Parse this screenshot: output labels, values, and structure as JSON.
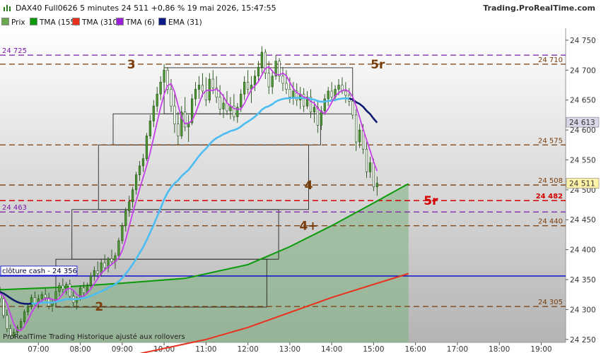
{
  "header": {
    "title": "DAX40 Full0626 5 minutes 24 511 +0,86 % 19 mai 2026, 15:47:55",
    "brand": "Trading.ProRealTime.com"
  },
  "legend": [
    {
      "label": "Prix",
      "color": "#6aa84f"
    },
    {
      "label": "TMA (155)",
      "color": "#0a9a0a"
    },
    {
      "label": "TMA (310)",
      "color": "#e8301c"
    },
    {
      "label": "TMA (6)",
      "color": "#9b1fd6"
    },
    {
      "label": "EMA (31)",
      "color": "#0d1a8a"
    }
  ],
  "footer_note": "ProRealTime Trading  Historique ajusté aux rollovers",
  "colors": {
    "bg_top": "#ffffff",
    "bg_bottom": "#b4b4b4",
    "candle_up": "#2d7a1e",
    "candle_down": "#2d7a1e",
    "tma155": "#0a9a0a",
    "tma310": "#e8301c",
    "tma6": "#c640e8",
    "ema31_light": "#4bbdf2",
    "ema31_dark": "#0d1a6e",
    "area_fill": "#7fb27f",
    "cash_line": "#0000cc",
    "level_brown": "#7a3d0c",
    "level_red": "#d40000",
    "level_purple": "#7a1aa8"
  },
  "chart_data": {
    "type": "candlestick",
    "instrument": "DAX40 Full0626",
    "timeframe": "5 minutes",
    "ylim": [
      24245,
      24770
    ],
    "xlim": [
      "06:05",
      "19:35"
    ],
    "x_ticks": [
      "07:00",
      "08:00",
      "09:00",
      "10:00",
      "11:00",
      "12:00",
      "13:00",
      "14:00",
      "15:00",
      "16:00",
      "17:00",
      "18:00",
      "19:00"
    ],
    "y_ticks": [
      24250,
      24300,
      24350,
      24400,
      24450,
      24500,
      24550,
      24600,
      24650,
      24700,
      24750
    ],
    "y_tick_labels": [
      "24 250",
      "24 300",
      "24 350",
      "24 400",
      "24 450",
      "24 500",
      "24 550",
      "24 600",
      "24 650",
      "24 700",
      "24 750"
    ],
    "last_price": {
      "label": "24 511",
      "value": 24511
    },
    "ema_label": {
      "label": "24 613",
      "value": 24613
    },
    "levels": [
      {
        "value": 24725,
        "label": "24 725",
        "side": "left",
        "style": "purple"
      },
      {
        "value": 24710,
        "label": "24 710",
        "side": "right",
        "style": "brown"
      },
      {
        "value": 24575,
        "label": "24 575",
        "side": "right",
        "style": "brown"
      },
      {
        "value": 24508,
        "label": "24 508",
        "side": "right",
        "style": "brown"
      },
      {
        "value": 24482,
        "label": "24 482",
        "side": "right",
        "style": "red"
      },
      {
        "value": 24463,
        "label": "24 463",
        "side": "left",
        "style": "purple"
      },
      {
        "value": 24440,
        "label": "24 440",
        "side": "right",
        "style": "brown"
      },
      {
        "value": 24305,
        "label": "24 305",
        "side": "right",
        "style": "brown"
      }
    ],
    "cash_close": {
      "label": "clôture cash -  24 356",
      "value": 24356
    },
    "annotations": [
      {
        "text": "3",
        "time": "09:13",
        "value": 24710,
        "color": "brown"
      },
      {
        "text": "5r",
        "time": "15:06",
        "value": 24710,
        "color": "brown"
      },
      {
        "text": "4",
        "time": "13:27",
        "value": 24508,
        "color": "brown"
      },
      {
        "text": "5r",
        "time": "16:22",
        "value": 24482,
        "color": "red"
      },
      {
        "text": "4+",
        "time": "13:27",
        "value": 24440,
        "color": "brown"
      },
      {
        "text": "2",
        "time": "08:27",
        "value": 24305,
        "color": "brown"
      }
    ],
    "boxes": [
      {
        "t0": "10:00",
        "t1": "14:30",
        "low": 24627,
        "high": 24704
      },
      {
        "t0": "08:47",
        "t1": "13:44",
        "low": 24575,
        "high": 24627
      },
      {
        "t0": "08:26",
        "t1": "13:27",
        "low": 24467,
        "high": 24575
      },
      {
        "t0": "07:48",
        "t1": "12:44",
        "low": 24384,
        "high": 24467
      },
      {
        "t0": "07:25",
        "t1": "12:27",
        "low": 24304,
        "high": 24384
      }
    ],
    "ohlc": [
      [
        "06:00",
        24345,
        24352,
        24325,
        24330
      ],
      [
        "06:05",
        24330,
        24338,
        24312,
        24318
      ],
      [
        "06:10",
        24318,
        24322,
        24285,
        24290
      ],
      [
        "06:15",
        24290,
        24300,
        24262,
        24268
      ],
      [
        "06:20",
        24268,
        24275,
        24250,
        24256
      ],
      [
        "06:25",
        24256,
        24268,
        24252,
        24262
      ],
      [
        "06:30",
        24262,
        24274,
        24258,
        24270
      ],
      [
        "06:35",
        24270,
        24285,
        24265,
        24280
      ],
      [
        "06:40",
        24280,
        24300,
        24276,
        24296
      ],
      [
        "06:45",
        24296,
        24310,
        24290,
        24305
      ],
      [
        "06:50",
        24305,
        24325,
        24300,
        24320
      ],
      [
        "06:55",
        24320,
        24330,
        24305,
        24310
      ],
      [
        "07:00",
        24310,
        24325,
        24302,
        24318
      ],
      [
        "07:05",
        24318,
        24330,
        24310,
        24325
      ],
      [
        "07:10",
        24325,
        24335,
        24315,
        24320
      ],
      [
        "07:15",
        24320,
        24328,
        24300,
        24306
      ],
      [
        "07:20",
        24306,
        24318,
        24296,
        24312
      ],
      [
        "07:25",
        24312,
        24335,
        24308,
        24330
      ],
      [
        "07:30",
        24330,
        24345,
        24322,
        24340
      ],
      [
        "07:35",
        24340,
        24352,
        24328,
        24334
      ],
      [
        "07:40",
        24334,
        24346,
        24325,
        24342
      ],
      [
        "07:45",
        24342,
        24350,
        24318,
        24322
      ],
      [
        "07:50",
        24322,
        24332,
        24305,
        24312
      ],
      [
        "07:55",
        24312,
        24322,
        24300,
        24318
      ],
      [
        "08:00",
        24318,
        24340,
        24315,
        24336
      ],
      [
        "08:05",
        24336,
        24346,
        24322,
        24328
      ],
      [
        "08:10",
        24328,
        24345,
        24326,
        24340
      ],
      [
        "08:15",
        24340,
        24362,
        24336,
        24356
      ],
      [
        "08:20",
        24356,
        24372,
        24348,
        24365
      ],
      [
        "08:25",
        24365,
        24380,
        24352,
        24360
      ],
      [
        "08:30",
        24360,
        24385,
        24355,
        24378
      ],
      [
        "08:35",
        24378,
        24392,
        24365,
        24370
      ],
      [
        "08:40",
        24370,
        24388,
        24362,
        24385
      ],
      [
        "08:45",
        24385,
        24400,
        24375,
        24380
      ],
      [
        "08:50",
        24380,
        24395,
        24368,
        24390
      ],
      [
        "08:55",
        24390,
        24420,
        24386,
        24415
      ],
      [
        "09:00",
        24415,
        24445,
        24410,
        24440
      ],
      [
        "09:05",
        24440,
        24470,
        24430,
        24465
      ],
      [
        "09:10",
        24465,
        24490,
        24455,
        24480
      ],
      [
        "09:15",
        24480,
        24505,
        24470,
        24500
      ],
      [
        "09:20",
        24500,
        24530,
        24492,
        24525
      ],
      [
        "09:25",
        24525,
        24548,
        24515,
        24540
      ],
      [
        "09:30",
        24540,
        24560,
        24530,
        24552
      ],
      [
        "09:35",
        24552,
        24595,
        24548,
        24590
      ],
      [
        "09:40",
        24590,
        24625,
        24585,
        24615
      ],
      [
        "09:45",
        24615,
        24650,
        24605,
        24640
      ],
      [
        "09:50",
        24640,
        24672,
        24630,
        24660
      ],
      [
        "09:55",
        24660,
        24690,
        24650,
        24680
      ],
      [
        "10:00",
        24680,
        24710,
        24670,
        24700
      ],
      [
        "10:05",
        24700,
        24705,
        24660,
        24668
      ],
      [
        "10:10",
        24668,
        24685,
        24630,
        24640
      ],
      [
        "10:15",
        24640,
        24660,
        24595,
        24610
      ],
      [
        "10:20",
        24610,
        24630,
        24575,
        24590
      ],
      [
        "10:25",
        24590,
        24640,
        24585,
        24630
      ],
      [
        "10:30",
        24630,
        24655,
        24598,
        24605
      ],
      [
        "10:35",
        24605,
        24625,
        24580,
        24612
      ],
      [
        "10:40",
        24612,
        24660,
        24608,
        24652
      ],
      [
        "10:45",
        24652,
        24680,
        24640,
        24668
      ],
      [
        "10:50",
        24668,
        24690,
        24652,
        24675
      ],
      [
        "10:55",
        24675,
        24695,
        24655,
        24665
      ],
      [
        "11:00",
        24665,
        24688,
        24640,
        24650
      ],
      [
        "11:05",
        24650,
        24695,
        24645,
        24685
      ],
      [
        "11:10",
        24685,
        24700,
        24660,
        24670
      ],
      [
        "11:15",
        24670,
        24690,
        24645,
        24655
      ],
      [
        "11:20",
        24655,
        24675,
        24625,
        24635
      ],
      [
        "11:25",
        24635,
        24660,
        24620,
        24645
      ],
      [
        "11:30",
        24645,
        24665,
        24625,
        24632
      ],
      [
        "11:35",
        24632,
        24655,
        24618,
        24640
      ],
      [
        "11:40",
        24640,
        24660,
        24615,
        24622
      ],
      [
        "11:45",
        24622,
        24645,
        24612,
        24638
      ],
      [
        "11:50",
        24638,
        24668,
        24630,
        24660
      ],
      [
        "11:55",
        24660,
        24690,
        24650,
        24680
      ],
      [
        "12:00",
        24680,
        24700,
        24660,
        24668
      ],
      [
        "12:05",
        24668,
        24690,
        24645,
        24675
      ],
      [
        "12:10",
        24675,
        24700,
        24665,
        24690
      ],
      [
        "12:15",
        24690,
        24715,
        24680,
        24705
      ],
      [
        "12:20",
        24705,
        24740,
        24695,
        24730
      ],
      [
        "12:25",
        24730,
        24735,
        24685,
        24695
      ],
      [
        "12:30",
        24695,
        24715,
        24660,
        24672
      ],
      [
        "12:35",
        24672,
        24700,
        24660,
        24690
      ],
      [
        "12:40",
        24690,
        24725,
        24684,
        24715
      ],
      [
        "12:45",
        24715,
        24720,
        24680,
        24690
      ],
      [
        "12:50",
        24690,
        24705,
        24665,
        24678
      ],
      [
        "12:55",
        24678,
        24700,
        24660,
        24668
      ],
      [
        "13:00",
        24668,
        24688,
        24645,
        24655
      ],
      [
        "13:05",
        24655,
        24680,
        24642,
        24665
      ],
      [
        "13:10",
        24665,
        24678,
        24640,
        24650
      ],
      [
        "13:15",
        24650,
        24672,
        24635,
        24660
      ],
      [
        "13:20",
        24660,
        24670,
        24630,
        24640
      ],
      [
        "13:25",
        24640,
        24665,
        24635,
        24655
      ],
      [
        "13:30",
        24655,
        24668,
        24620,
        24630
      ],
      [
        "13:35",
        24630,
        24648,
        24612,
        24638
      ],
      [
        "13:40",
        24638,
        24650,
        24595,
        24608
      ],
      [
        "13:45",
        24608,
        24640,
        24600,
        24632
      ],
      [
        "13:50",
        24632,
        24660,
        24625,
        24652
      ],
      [
        "13:55",
        24652,
        24672,
        24640,
        24665
      ],
      [
        "14:00",
        24665,
        24680,
        24645,
        24655
      ],
      [
        "14:05",
        24655,
        24675,
        24648,
        24668
      ],
      [
        "14:10",
        24668,
        24685,
        24658,
        24675
      ],
      [
        "14:15",
        24675,
        24688,
        24660,
        24665
      ],
      [
        "14:20",
        24665,
        24680,
        24645,
        24658
      ],
      [
        "14:25",
        24658,
        24670,
        24640,
        24648
      ],
      [
        "14:30",
        24648,
        24660,
        24618,
        24625
      ],
      [
        "14:35",
        24625,
        24635,
        24565,
        24580
      ],
      [
        "14:40",
        24580,
        24610,
        24570,
        24600
      ],
      [
        "14:45",
        24600,
        24610,
        24560,
        24568
      ],
      [
        "14:50",
        24568,
        24580,
        24520,
        24530
      ],
      [
        "14:55",
        24530,
        24555,
        24520,
        24545
      ],
      [
        "15:00",
        24545,
        24552,
        24498,
        24505
      ],
      [
        "15:05",
        24505,
        24522,
        24490,
        24511
      ]
    ]
  }
}
